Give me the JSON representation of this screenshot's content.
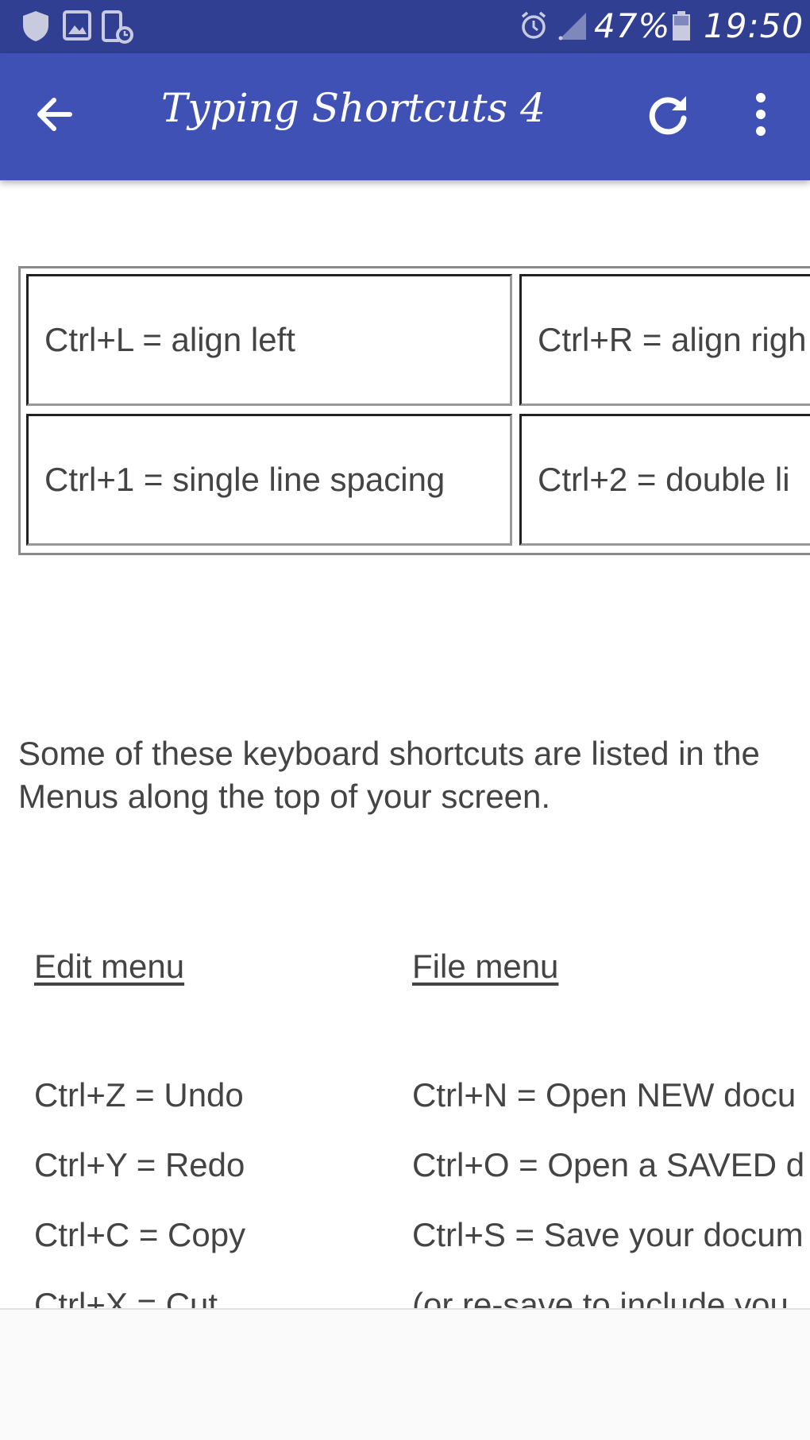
{
  "status_bar": {
    "battery": "47%",
    "time": "19:50",
    "icons": [
      "shield-icon",
      "image-icon",
      "phone-clock-icon",
      "alarm-icon",
      "signal-icon",
      "battery-icon"
    ]
  },
  "app_bar": {
    "title": "Typing Shortcuts 4",
    "icons": [
      "back-arrow-icon",
      "refresh-icon",
      "more-vert-icon"
    ]
  },
  "table": {
    "rows": [
      [
        "Ctrl+L = align left",
        "Ctrl+R = align righ"
      ],
      [
        "Ctrl+1 = single line spacing",
        "Ctrl+2 = double li"
      ]
    ]
  },
  "intro": "Some of these keyboard shortcuts are listed in the Menus along the top of your screen.",
  "edit_menu": {
    "heading": "Edit menu",
    "items": [
      "Ctrl+Z = Undo",
      "Ctrl+Y = Redo",
      "Ctrl+C = Copy",
      "Ctrl+X = Cut"
    ]
  },
  "file_menu": {
    "heading": "File menu",
    "items": [
      "Ctrl+N = Open NEW docu",
      "Ctrl+O = Open a SAVED d",
      "Ctrl+S = Save your docum",
      "(or re-save to include you"
    ]
  },
  "colors": {
    "status_bar": "#303f91",
    "app_bar": "#3f51b5",
    "text": "#444444"
  }
}
